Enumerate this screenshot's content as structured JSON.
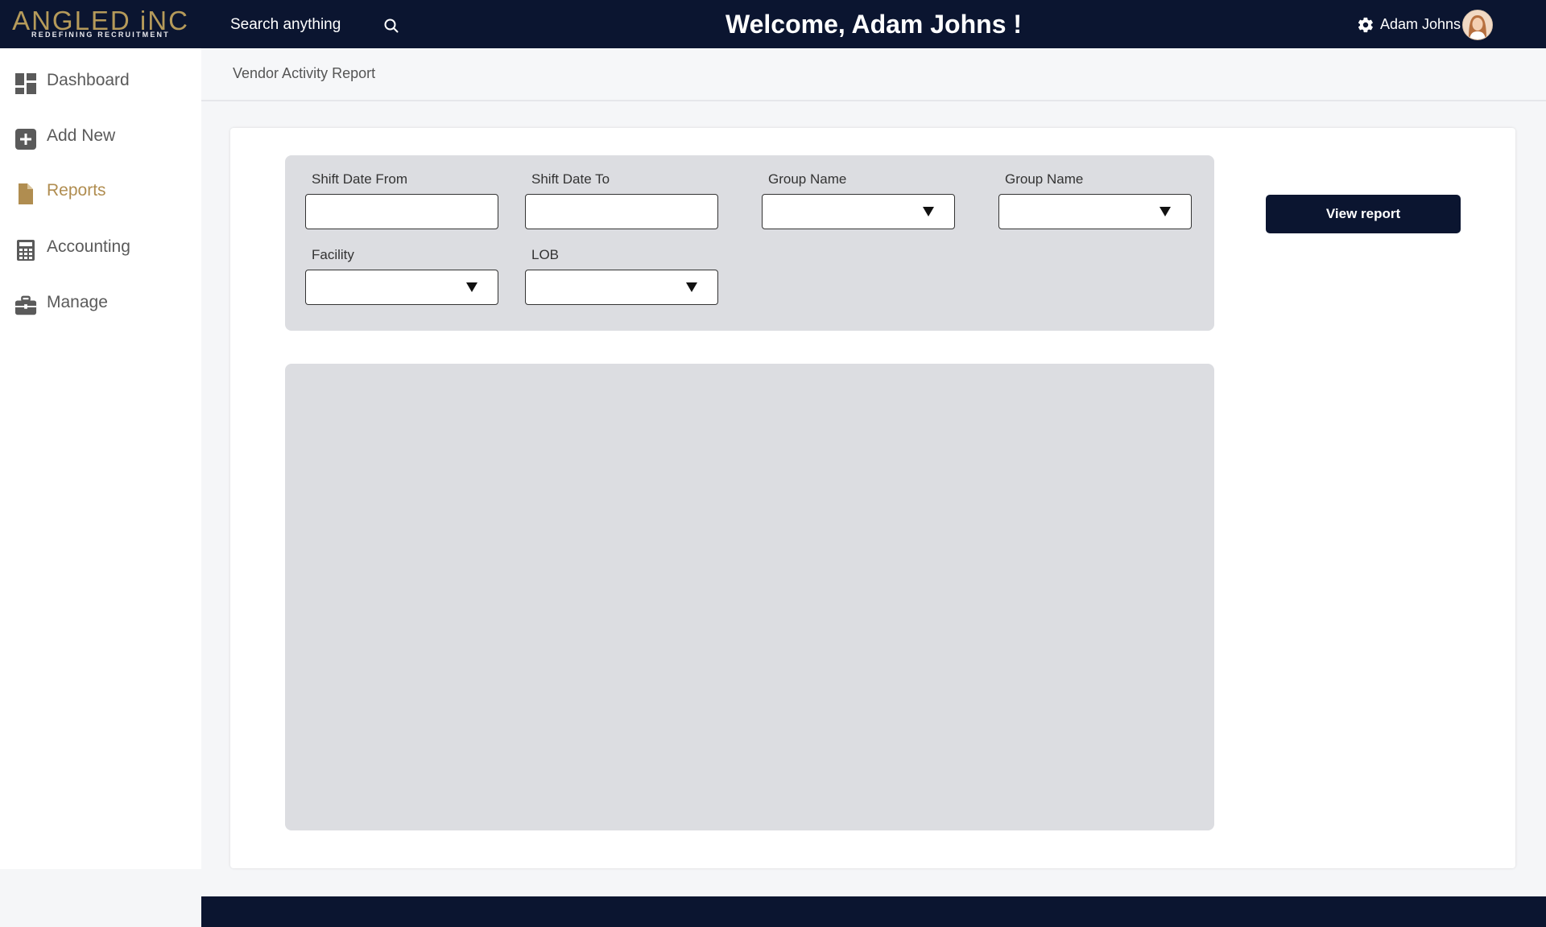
{
  "brand": {
    "name": "ANGLED iNC",
    "tagline": "REDEFINING RECRUITMENT",
    "gold": "#b59a5a",
    "navy": "#0b1530"
  },
  "topbar": {
    "search_placeholder": "Search anything",
    "welcome": "Welcome, Adam Johns !",
    "user_name": "Adam Johns"
  },
  "sidebar": {
    "items": [
      {
        "label": "Dashboard",
        "icon": "dashboard-icon",
        "active": false
      },
      {
        "label": "Add New",
        "icon": "plus-square-icon",
        "active": false
      },
      {
        "label": "Reports",
        "icon": "file-icon",
        "active": true
      },
      {
        "label": "Accounting",
        "icon": "calculator-icon",
        "active": false
      },
      {
        "label": "Manage",
        "icon": "briefcase-icon",
        "active": false
      }
    ]
  },
  "page": {
    "title": "Vendor Activity Report"
  },
  "filters": {
    "shift_date_from": {
      "label": "Shift Date From",
      "value": ""
    },
    "shift_date_to": {
      "label": "Shift Date To",
      "value": ""
    },
    "group_name_1": {
      "label": "Group Name",
      "value": ""
    },
    "group_name_2": {
      "label": "Group Name",
      "value": ""
    },
    "facility": {
      "label": "Facility",
      "value": ""
    },
    "lob": {
      "label": "LOB",
      "value": ""
    }
  },
  "actions": {
    "view_report": "View report"
  }
}
